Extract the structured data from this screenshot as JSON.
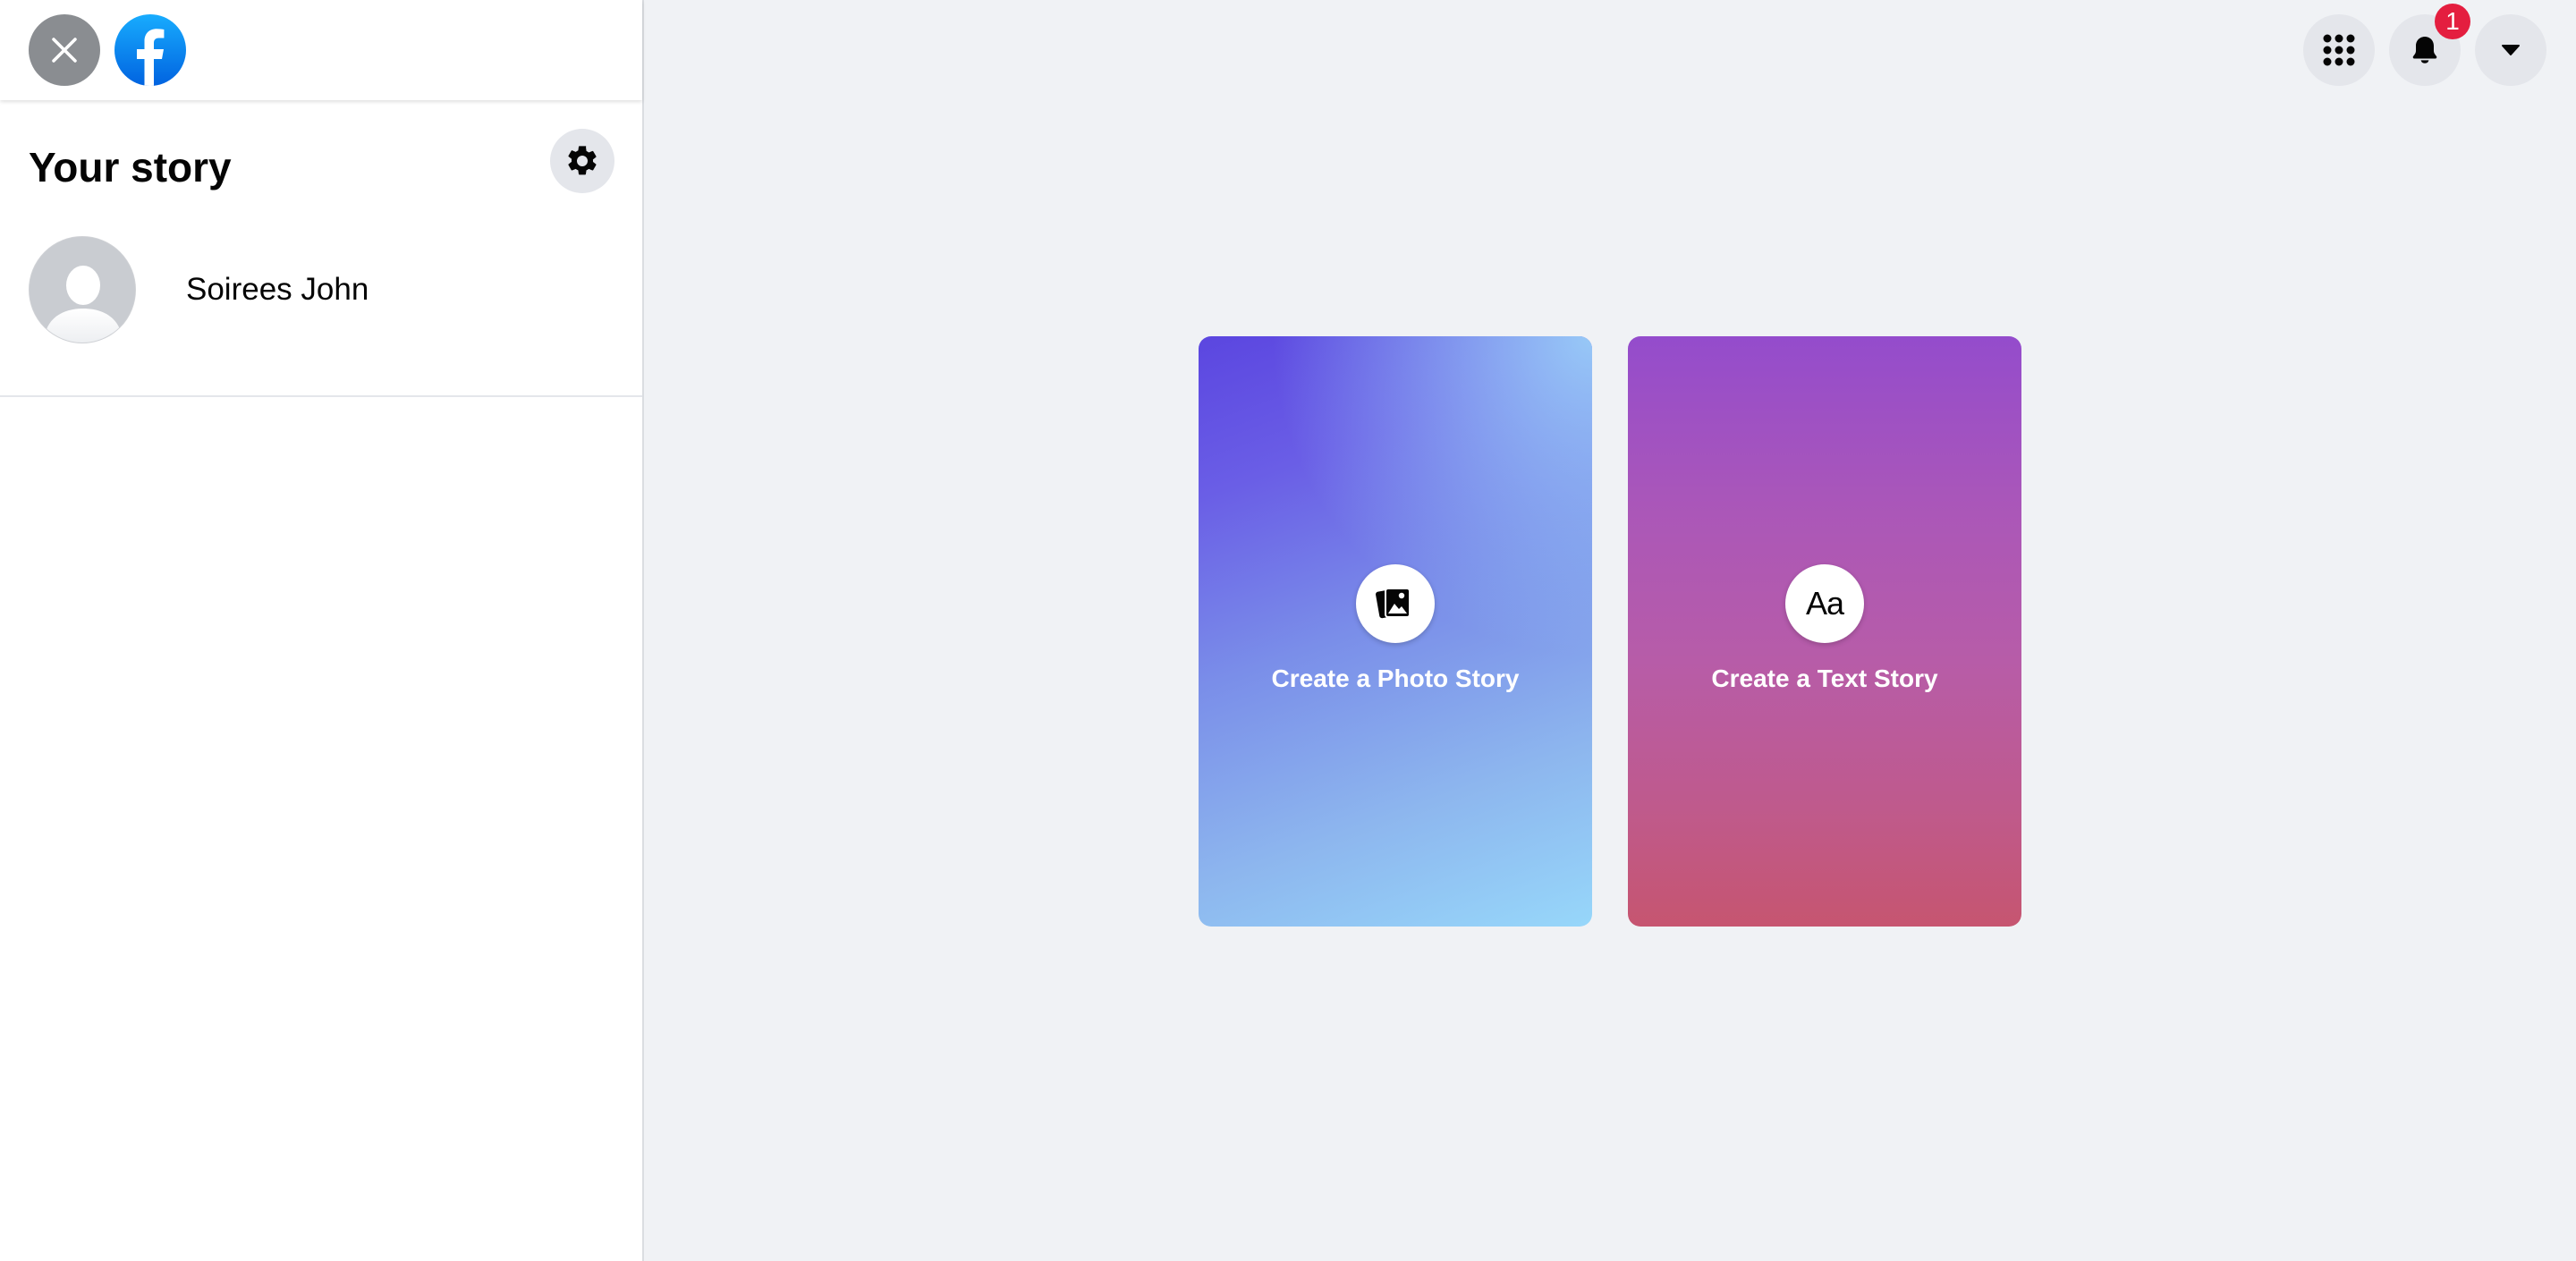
{
  "sidebar": {
    "title": "Your story",
    "profile": {
      "name": "Soirees John"
    }
  },
  "topbar": {
    "notifications_count": "1"
  },
  "cards": {
    "photo": {
      "label": "Create a Photo Story",
      "icon": "photo-icon"
    },
    "text": {
      "label": "Create a Text Story",
      "icon": "text-aa-icon",
      "icon_glyph": "Aa"
    }
  },
  "colors": {
    "brand_blue": "#0866ff",
    "notification_red": "#e41e3f",
    "page_bg": "#f0f2f5"
  }
}
